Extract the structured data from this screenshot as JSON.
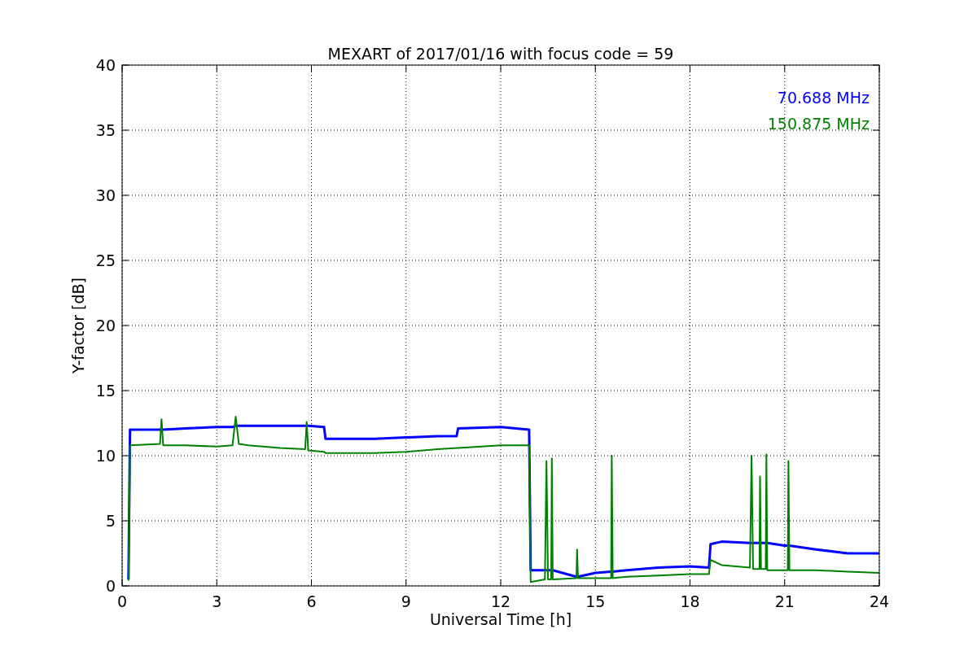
{
  "figure": {
    "chart_data": {
      "type": "line",
      "grid": true,
      "title": "MEXART of 2017/01/16 with focus code = 59",
      "xlabel": "Universal Time [h]",
      "ylabel": "Y-factor [dB]",
      "xlim": [
        0,
        24
      ],
      "ylim": [
        0,
        40
      ],
      "xticks": [
        0,
        3,
        6,
        9,
        12,
        15,
        18,
        21,
        24
      ],
      "yticks": [
        0,
        5,
        10,
        15,
        20,
        25,
        30,
        35,
        40
      ],
      "x": [
        0.2,
        0.25,
        1.2,
        1.25,
        1.3,
        2,
        3,
        3.5,
        3.6,
        3.7,
        4,
        5,
        5.8,
        5.85,
        5.9,
        6.4,
        6.45,
        8,
        9,
        10,
        10.6,
        10.65,
        12,
        12.9,
        12.95,
        13.4,
        13.45,
        13.5,
        13.6,
        13.62,
        13.65,
        14.4,
        14.42,
        14.45,
        15,
        15.5,
        15.52,
        15.55,
        16,
        17,
        18,
        18.6,
        18.65,
        19,
        19.9,
        19.95,
        20,
        20.2,
        20.22,
        20.25,
        20.4,
        20.42,
        20.45,
        21,
        21.1,
        21.12,
        21.15,
        22,
        23,
        24
      ],
      "series": [
        {
          "name": "70.688 MHz",
          "color": "#0000ff",
          "values": [
            0.5,
            12,
            12,
            12,
            12,
            12.1,
            12.2,
            12.2,
            12.3,
            12.3,
            12.3,
            12.3,
            12.3,
            12.3,
            12.3,
            12.2,
            11.3,
            11.3,
            11.4,
            11.5,
            11.5,
            12.1,
            12.2,
            12,
            1.2,
            1.2,
            1.2,
            1.2,
            1.2,
            1.2,
            1.2,
            0.7,
            0.7,
            0.7,
            1,
            1.1,
            1.1,
            1.1,
            1.2,
            1.4,
            1.5,
            1.4,
            3.2,
            3.4,
            3.3,
            3.3,
            3.3,
            3.3,
            3.3,
            3.3,
            3.3,
            3.3,
            3.3,
            3.1,
            3.1,
            3.1,
            3.1,
            2.8,
            2.5,
            2.5
          ]
        },
        {
          "name": "150.875 MHz",
          "color": "#008000",
          "values": [
            0.4,
            10.8,
            10.9,
            12.8,
            10.8,
            10.8,
            10.7,
            10.8,
            13,
            10.9,
            10.8,
            10.6,
            10.5,
            12.6,
            10.4,
            10.3,
            10.2,
            10.2,
            10.3,
            10.5,
            10.6,
            10.6,
            10.8,
            10.8,
            0.3,
            0.5,
            9.6,
            0.5,
            0.5,
            9.8,
            0.5,
            0.6,
            2.8,
            0.6,
            0.6,
            0.6,
            10,
            0.6,
            0.7,
            0.8,
            0.9,
            0.9,
            2,
            1.6,
            1.4,
            10,
            1.3,
            1.3,
            8.4,
            1.3,
            1.3,
            10.1,
            1.2,
            1.2,
            1.2,
            9.6,
            1.2,
            1.2,
            1.1,
            1
          ]
        }
      ]
    }
  }
}
